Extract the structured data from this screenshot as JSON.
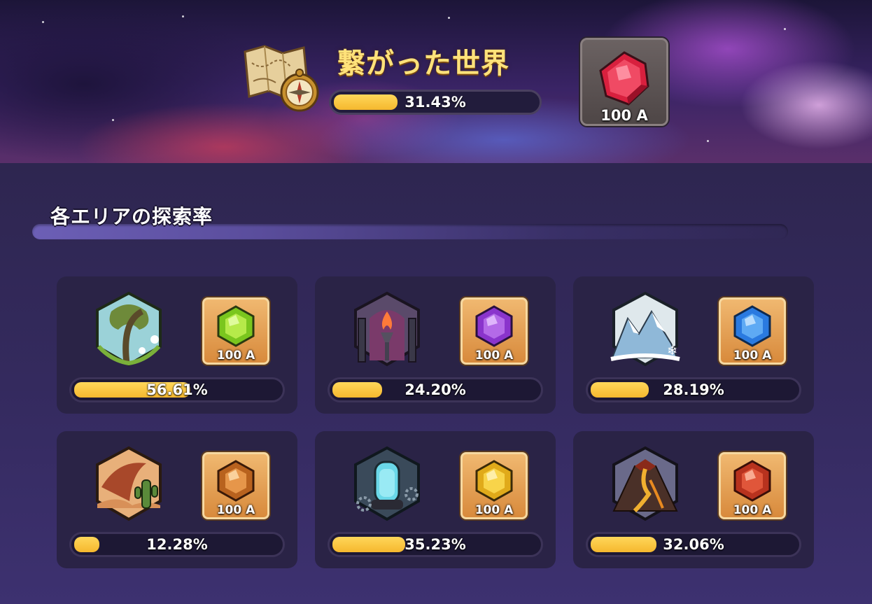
{
  "header": {
    "title": "繋がった世界",
    "progress_percent": 31.43,
    "progress_label": "31.43%",
    "icon": "map-compass-icon",
    "reward": {
      "icon": "red-gem-icon",
      "amount": "100 A",
      "color": "#e0304a"
    }
  },
  "section": {
    "title": "各エリアの探索率"
  },
  "areas": [
    {
      "icon": "forest-area-icon",
      "progress_percent": 56.61,
      "progress_label": "56.61%",
      "reward_icon": "green-gem-icon",
      "reward_amount": "100 A",
      "gem_color": "#8fd22a"
    },
    {
      "icon": "temple-area-icon",
      "progress_percent": 24.2,
      "progress_label": "24.20%",
      "reward_icon": "purple-gem-icon",
      "reward_amount": "100 A",
      "gem_color": "#9a4ad8"
    },
    {
      "icon": "snow-area-icon",
      "progress_percent": 28.19,
      "progress_label": "28.19%",
      "reward_icon": "blue-gem-icon",
      "reward_amount": "100 A",
      "gem_color": "#3a86e8"
    },
    {
      "icon": "desert-area-icon",
      "progress_percent": 12.28,
      "progress_label": "12.28%",
      "reward_icon": "amber-gem-icon",
      "reward_amount": "100 A",
      "gem_color": "#c8762e"
    },
    {
      "icon": "lab-area-icon",
      "progress_percent": 35.23,
      "progress_label": "35.23%",
      "reward_icon": "yellow-gem-icon",
      "reward_amount": "100 A",
      "gem_color": "#e8b82a"
    },
    {
      "icon": "volcano-area-icon",
      "progress_percent": 32.06,
      "progress_label": "32.06%",
      "reward_icon": "red-gem-icon",
      "reward_amount": "100 A",
      "gem_color": "#c83a2a"
    }
  ],
  "colors": {
    "progress_fill": "#f5b82e",
    "title_gold": "#ffe27a",
    "card_bg": "#2a2346",
    "reward_bg": "#e0a05a"
  }
}
